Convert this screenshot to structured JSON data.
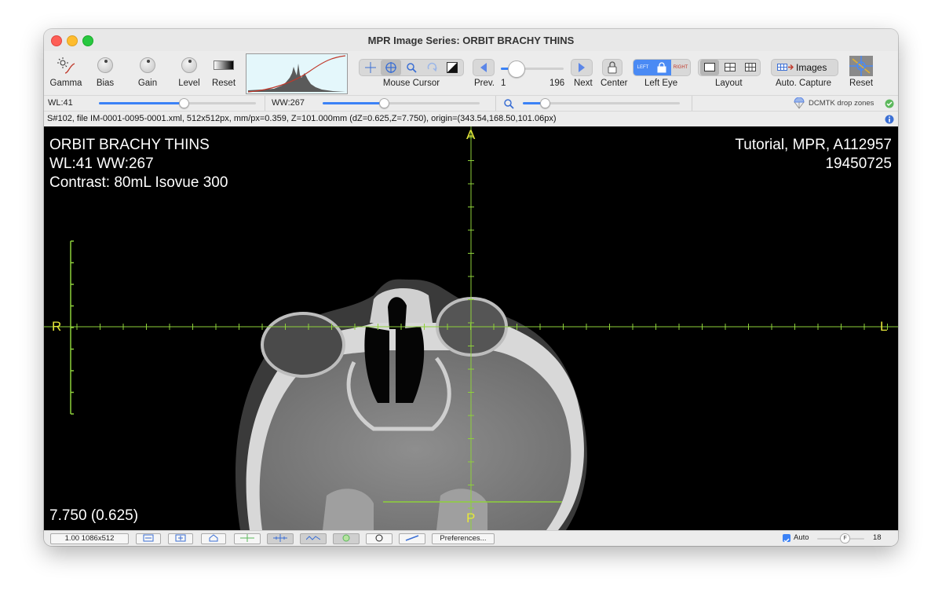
{
  "window": {
    "title": "MPR Image Series: ORBIT BRACHY THINS"
  },
  "toolbar": {
    "gamma": "Gamma",
    "bias": "Bias",
    "gain": "Gain",
    "level": "Level",
    "reset": "Reset",
    "mouse_cursor": "Mouse Cursor",
    "prev": "Prev.",
    "slice_min": "1",
    "slice_max": "196",
    "slice_position": 0.25,
    "next": "Next",
    "center": "Center",
    "left_eye": "Left Eye",
    "eye_left": "LEFT",
    "eye_right": "RIGHT",
    "layout": "Layout",
    "images": "Images",
    "auto_capture": "Auto. Capture",
    "reset2": "Reset"
  },
  "sliders": {
    "wl_label": "WL:41",
    "wl_value": 0.54,
    "ww_label": "WW:267",
    "ww_value": 0.39,
    "zoom_value": 0.14,
    "dcmtk": "DCMTK drop zones"
  },
  "info": {
    "text": "S#102, file IM-0001-0095-0001.xml, 512x512px, mm/px=0.359, Z=101.000mm (dZ=0.625,Z=7.750), origin=(343.54,168.50,101.06px)"
  },
  "overlay": {
    "series": "ORBIT BRACHY THINS",
    "window": "WL:41 WW:267",
    "contrast": "Contrast: 80mL Isovue 300",
    "study": "Tutorial, MPR, A112957",
    "date": "19450725",
    "position": "7.750 (0.625)",
    "orient_a": "A",
    "orient_p": "P",
    "orient_r": "R",
    "orient_l": "L"
  },
  "status": {
    "zoom": "1.00 1086x512",
    "preferences": "Preferences...",
    "auto": "Auto",
    "auto_checked": true,
    "f_label": "F",
    "f_value": "18"
  },
  "colors": {
    "accent": "#3b82f6",
    "crosshair": "#8ed13a",
    "orient": "#e6e63a",
    "hist_curve": "#c0392b"
  }
}
